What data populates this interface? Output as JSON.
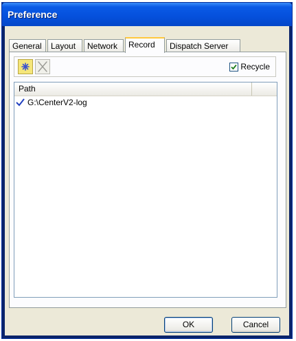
{
  "window": {
    "title": "Preference"
  },
  "tabs": [
    {
      "label": "General"
    },
    {
      "label": "Layout"
    },
    {
      "label": "Network"
    },
    {
      "label": "Record",
      "active": true
    },
    {
      "label": "Dispatch Server"
    }
  ],
  "toolbar": {
    "add_icon": "add-star-icon",
    "delete_icon": "delete-x-icon",
    "recycle_label": "Recycle",
    "recycle_checked": true
  },
  "list": {
    "columns": [
      "Path"
    ],
    "rows": [
      {
        "path": "G:\\CenterV2-log",
        "checked": true
      }
    ]
  },
  "buttons": {
    "ok": "OK",
    "cancel": "Cancel"
  },
  "colors": {
    "title_bar": "#0550dc",
    "tab_highlight": "#ffc83c",
    "check": "#1c7c1c"
  }
}
